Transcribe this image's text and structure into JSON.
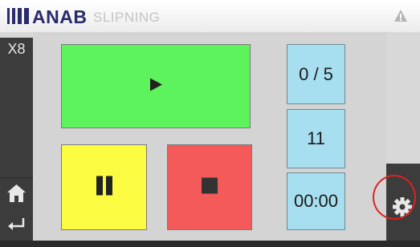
{
  "header": {
    "brand": "ANAB",
    "subtitle": "SLIPNING"
  },
  "sidebar": {
    "multiplier": "X8",
    "icons": [
      "home-icon",
      "back-icon"
    ]
  },
  "controls": {
    "play_icon": "play-icon",
    "pause_icon": "pause-icon",
    "stop_icon": "stop-icon",
    "colors": {
      "play": "#5df35d",
      "pause": "#fbfb42",
      "stop": "#f45a5a"
    }
  },
  "info": {
    "count": "0 / 5",
    "number": "11",
    "time": "00:00",
    "color": "#a8dff0"
  },
  "settings": {
    "icon": "gear-icon",
    "highlight_color": "#e02020"
  },
  "brand_color": "#2a2a6e"
}
